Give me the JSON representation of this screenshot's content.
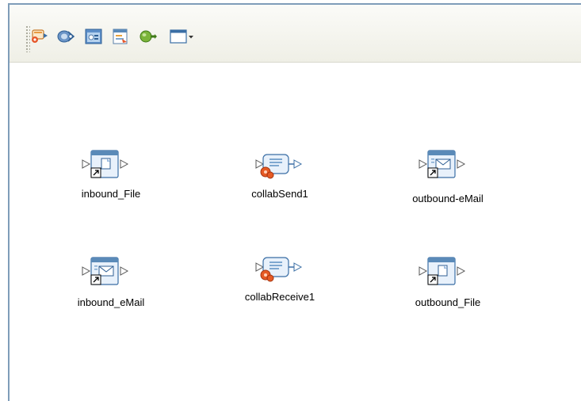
{
  "toolbar": {
    "buttons": [
      {
        "icon": "external-application-icon"
      },
      {
        "icon": "service-icon"
      },
      {
        "icon": "web-service-icon"
      },
      {
        "icon": "business-process-icon"
      },
      {
        "icon": "connector-icon"
      },
      {
        "icon": "window-dropdown-icon"
      }
    ]
  },
  "nodes": [
    {
      "label": "inbound_File",
      "type": "file"
    },
    {
      "label": "collabSend1",
      "type": "collab"
    },
    {
      "label": "outbound-eMail",
      "type": "email"
    },
    {
      "label": "inbound_eMail",
      "type": "email"
    },
    {
      "label": "collabReceive1",
      "type": "collab"
    },
    {
      "label": "outbound_File",
      "type": "file"
    }
  ],
  "colors": {
    "border": "#7f9db9",
    "toolbar_bg": "#f3f3ec",
    "collab_gear": "#e65a24",
    "icon_frame": "#5a8ab8"
  }
}
